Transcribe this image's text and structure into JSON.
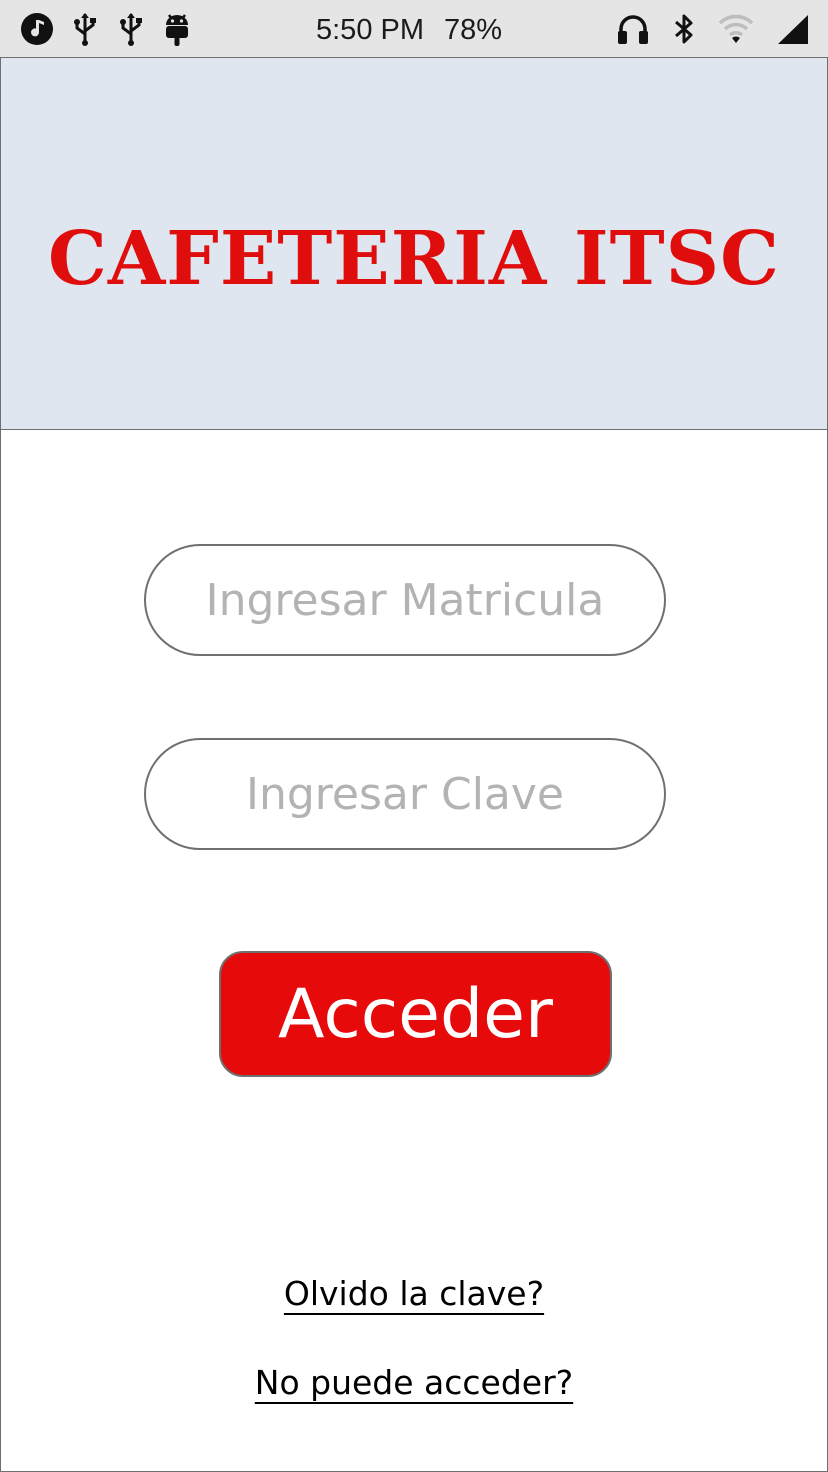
{
  "status_bar": {
    "time": "5:50 PM",
    "battery": "78%",
    "left_icons": [
      "music-note-icon",
      "usb-icon",
      "usb-icon",
      "android-icon"
    ],
    "right_icons": [
      "headphones-icon",
      "bluetooth-icon",
      "wifi-icon",
      "signal-icon"
    ]
  },
  "header": {
    "title": "CAFETERIA ITSC",
    "title_color": "#e00d0d",
    "background": "#dfe6ef"
  },
  "form": {
    "matricula_placeholder": "Ingresar Matricula",
    "matricula_value": "",
    "clave_placeholder": "Ingresar Clave",
    "clave_value": "",
    "submit_label": "Acceder",
    "submit_color": "#e60a0a"
  },
  "links": {
    "forgot": "Olvido la clave?",
    "cannot_access": "No puede acceder?"
  }
}
